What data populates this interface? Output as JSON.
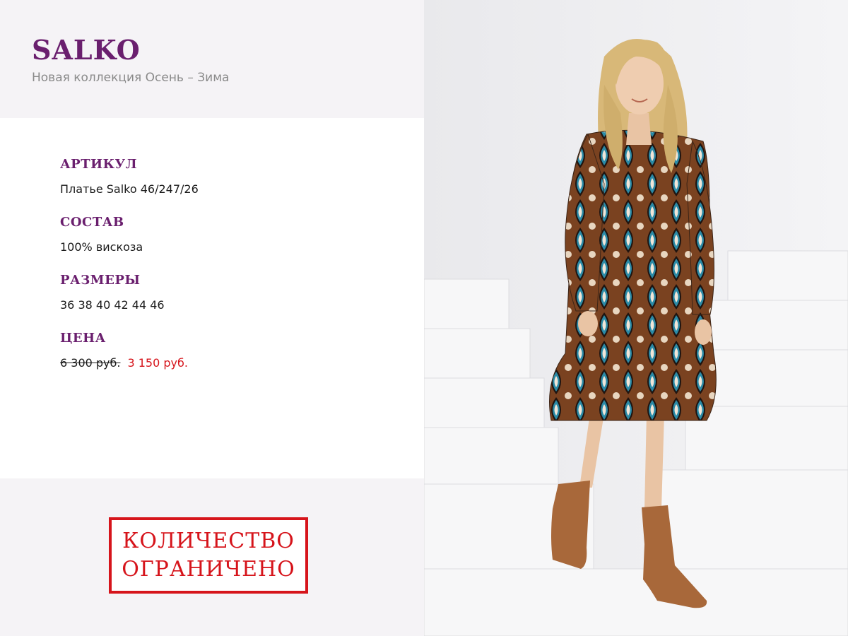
{
  "header": {
    "brand": "SALKO",
    "subtitle": "Новая коллекция Осень – Зима"
  },
  "details": {
    "article_label": "АРТИКУЛ",
    "article_value": "Платье Salko 46/247/26",
    "composition_label": "СОСТАВ",
    "composition_value": "100% вискоза",
    "sizes_label": "РАЗМЕРЫ",
    "sizes_value": "36 38 40 42 44 46",
    "price_label": "ЦЕНА",
    "price_old": "6 300 руб.",
    "price_new": "3 150 руб."
  },
  "stamp": {
    "line1": "КОЛИЧЕСТВО",
    "line2": "ОГРАНИЧЕНО"
  },
  "colors": {
    "brand": "#6a1f6e",
    "sale": "#d6141b",
    "dress_teal": "#2a8aa6",
    "dress_brown": "#8a4a22",
    "boots": "#a8683a"
  },
  "photo": {
    "subject": "woman in patterned dress and suede ankle boots on white stairs"
  }
}
